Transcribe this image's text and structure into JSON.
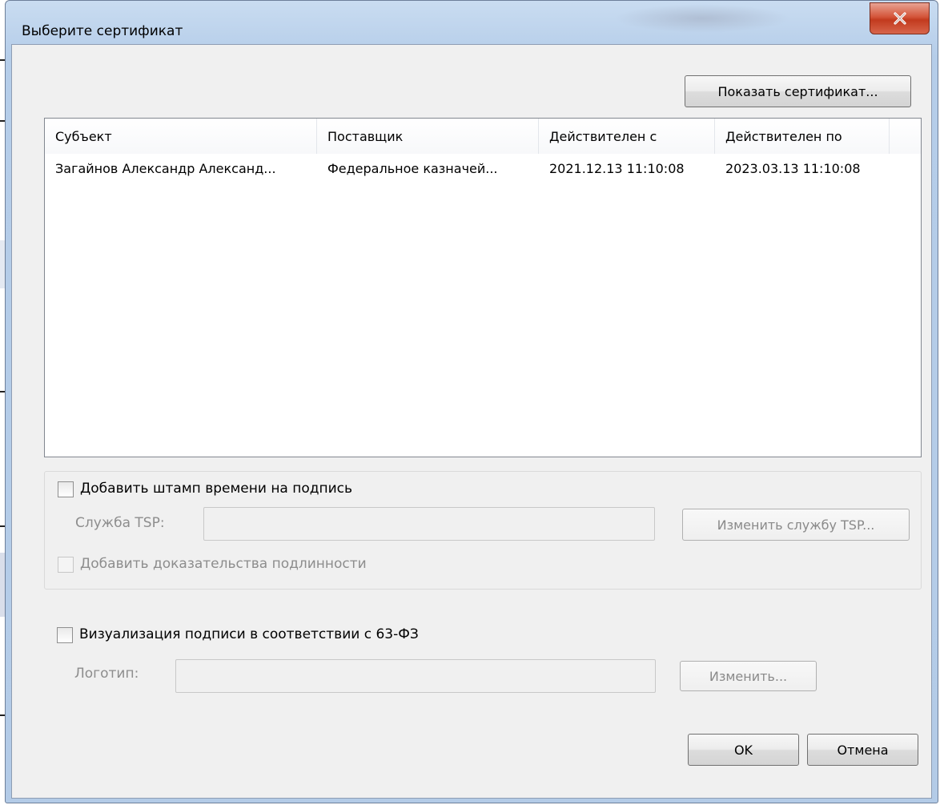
{
  "window": {
    "title": "Выберите сертификат",
    "close_glyph": "X"
  },
  "toolbar": {
    "show_certificate_label": "Показать сертификат..."
  },
  "certificates": {
    "columns": [
      "Субъект",
      "Поставщик",
      "Действителен с",
      "Действителен по"
    ],
    "rows": [
      {
        "subject": "Загайнов Александр Александ...",
        "issuer": "Федеральное казначей...",
        "valid_from": "2021.12.13 11:10:08",
        "valid_to": "2023.03.13 11:10:08"
      }
    ]
  },
  "timestamp_group": {
    "add_timestamp_label": "Добавить штамп времени на подпись",
    "add_timestamp_checked": false,
    "tsp_label": "Служба TSP:",
    "tsp_value": "",
    "change_tsp_label": "Изменить службу TSP...",
    "add_evidence_label": "Добавить доказательства подлинности",
    "add_evidence_checked": false
  },
  "visualization": {
    "label": "Визуализация подписи в соответствии с 63-ФЗ",
    "checked": false,
    "logo_label": "Логотип:",
    "logo_value": "",
    "change_label": "Изменить..."
  },
  "footer": {
    "ok_label": "OK",
    "cancel_label": "Отмена"
  },
  "colors": {
    "title_bar": "#b9d1ea",
    "close_button": "#c94a30",
    "dialog_bg": "#f0f0f0",
    "disabled_text": "#8d8d8d"
  }
}
